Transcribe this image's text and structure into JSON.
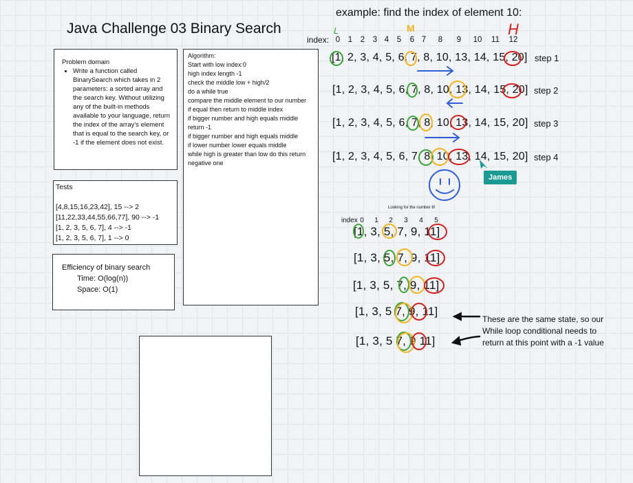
{
  "title": "Java Challenge 03 Binary Search",
  "example_title": "example: find the index of element 10:",
  "index_label": "index:",
  "indices_top": [
    "0",
    "1",
    "2",
    "3",
    "4",
    "5",
    "6",
    "7",
    "8",
    "9",
    "10",
    "11",
    "12"
  ],
  "low_mark": "L",
  "mid_mark": "M",
  "high_mark": "H",
  "problem": {
    "heading": "Problem domain",
    "bullet": "Write a function called BinarySearch which takes in 2 parameters: a sorted array and the search key. Without utilizing any of the built-in methods available to your language, return the index of the array’s element that is equal to the search key, or -1 if the element does not exist."
  },
  "tests": {
    "heading": "Tests",
    "lines": [
      "[4,8,15,16,23,42], 15 --> 2",
      "[11,22,33,44,55,66,77], 90 --> -1",
      "[1, 2, 3, 5, 6, 7], 4 --> -1",
      "[1, 2, 3, 5, 6, 7], 1 --> 0"
    ]
  },
  "efficiency": {
    "heading": "Efficiency of binary search",
    "time": "Time: O(log(n))",
    "space": "Space: O(1)"
  },
  "algorithm": {
    "lines": [
      "Algorithm:",
      "Start with low index:0",
      "high index length -1",
      "check the middle low + high/2",
      "do a while true",
      "compare the middle element to our number",
      "if equal then return to middle index",
      "if bigger number and high equals middle",
      "return -1",
      "if bigger number and high equals middle",
      "if lower number lower equals middle",
      "while high is greater than low do this return",
      "negative one"
    ]
  },
  "example_rows": [
    {
      "text": "[1, 2, 3, 4, 5, 6, 7, 8, 10, 13, 14, 15, 20]",
      "step": "step 1"
    },
    {
      "text": "[1, 2, 3, 4, 5, 6, 7, 8, 10, 13, 14, 15, 20]",
      "step": "step 2"
    },
    {
      "text": "[1, 2, 3, 4, 5, 6, 7, 8, 10, 13, 14, 15, 20]",
      "step": "step 3"
    },
    {
      "text": "[1, 2, 3, 4, 5, 6, 7, 8, 10, 13, 14, 15, 20]",
      "step": "step 4"
    }
  ],
  "cursor_label": "James",
  "second_example": {
    "title": "Looking for the number 8!",
    "index_label": "index",
    "indices": [
      "0",
      "1",
      "2",
      "3",
      "4",
      "5"
    ],
    "rows": [
      "[1, 3, 5, 7, 9, 11]",
      "[1, 3, 5, 7, 9, 11]",
      "[1, 3, 5, 7, 9, 11]",
      "[1, 3, 5 7, 9, 11]",
      "[1, 3, 5 7, 9  11]"
    ]
  },
  "note": "These are the same state, so our While loop conditional needs to return at this point with a -1 value",
  "colors": {
    "green": "#3aa53a",
    "orange": "#f0b323",
    "red": "#d11f1f",
    "blue": "#2f5fd8",
    "teal": "#1a9a93"
  }
}
